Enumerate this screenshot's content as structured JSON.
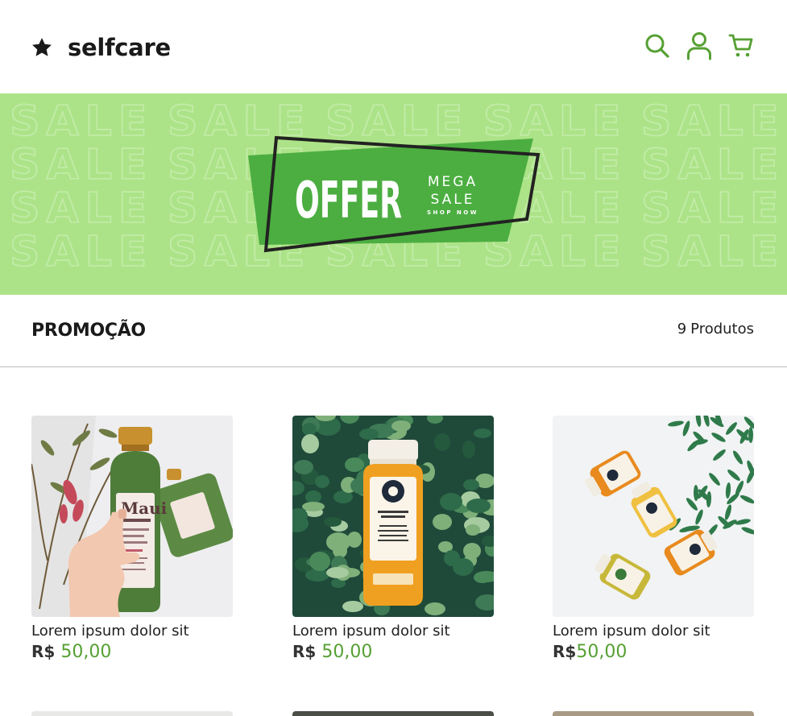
{
  "brand": {
    "name": "selfcare",
    "icon": "star-icon"
  },
  "header": {
    "icons": [
      "search-icon",
      "user-icon",
      "cart-icon"
    ],
    "accent": "#56a033"
  },
  "banner": {
    "background_word": "SALE",
    "offer_title": "OFFER",
    "line1": "MEGA",
    "line2": "SALE",
    "cta": "SHOP NOW",
    "colors": {
      "bg": "#ade388",
      "badge": "#4cae41",
      "frame": "#222222"
    }
  },
  "section": {
    "title": "PROMOÇÃO",
    "count_number": "9",
    "count_label": "Produtos"
  },
  "products": [
    {
      "name": "Lorem ipsum dolor sit",
      "currency": "R$",
      "price": "50,00",
      "image": "green shampoo bottle held in hand"
    },
    {
      "name": "Lorem ipsum dolor sit",
      "currency": "R$",
      "price": "50,00",
      "image": "orange juice bottle on leaves"
    },
    {
      "name": "Lorem ipsum dolor sit",
      "currency": "R$",
      "price": "50,00",
      "image": "juice shot bottles with plant"
    }
  ]
}
